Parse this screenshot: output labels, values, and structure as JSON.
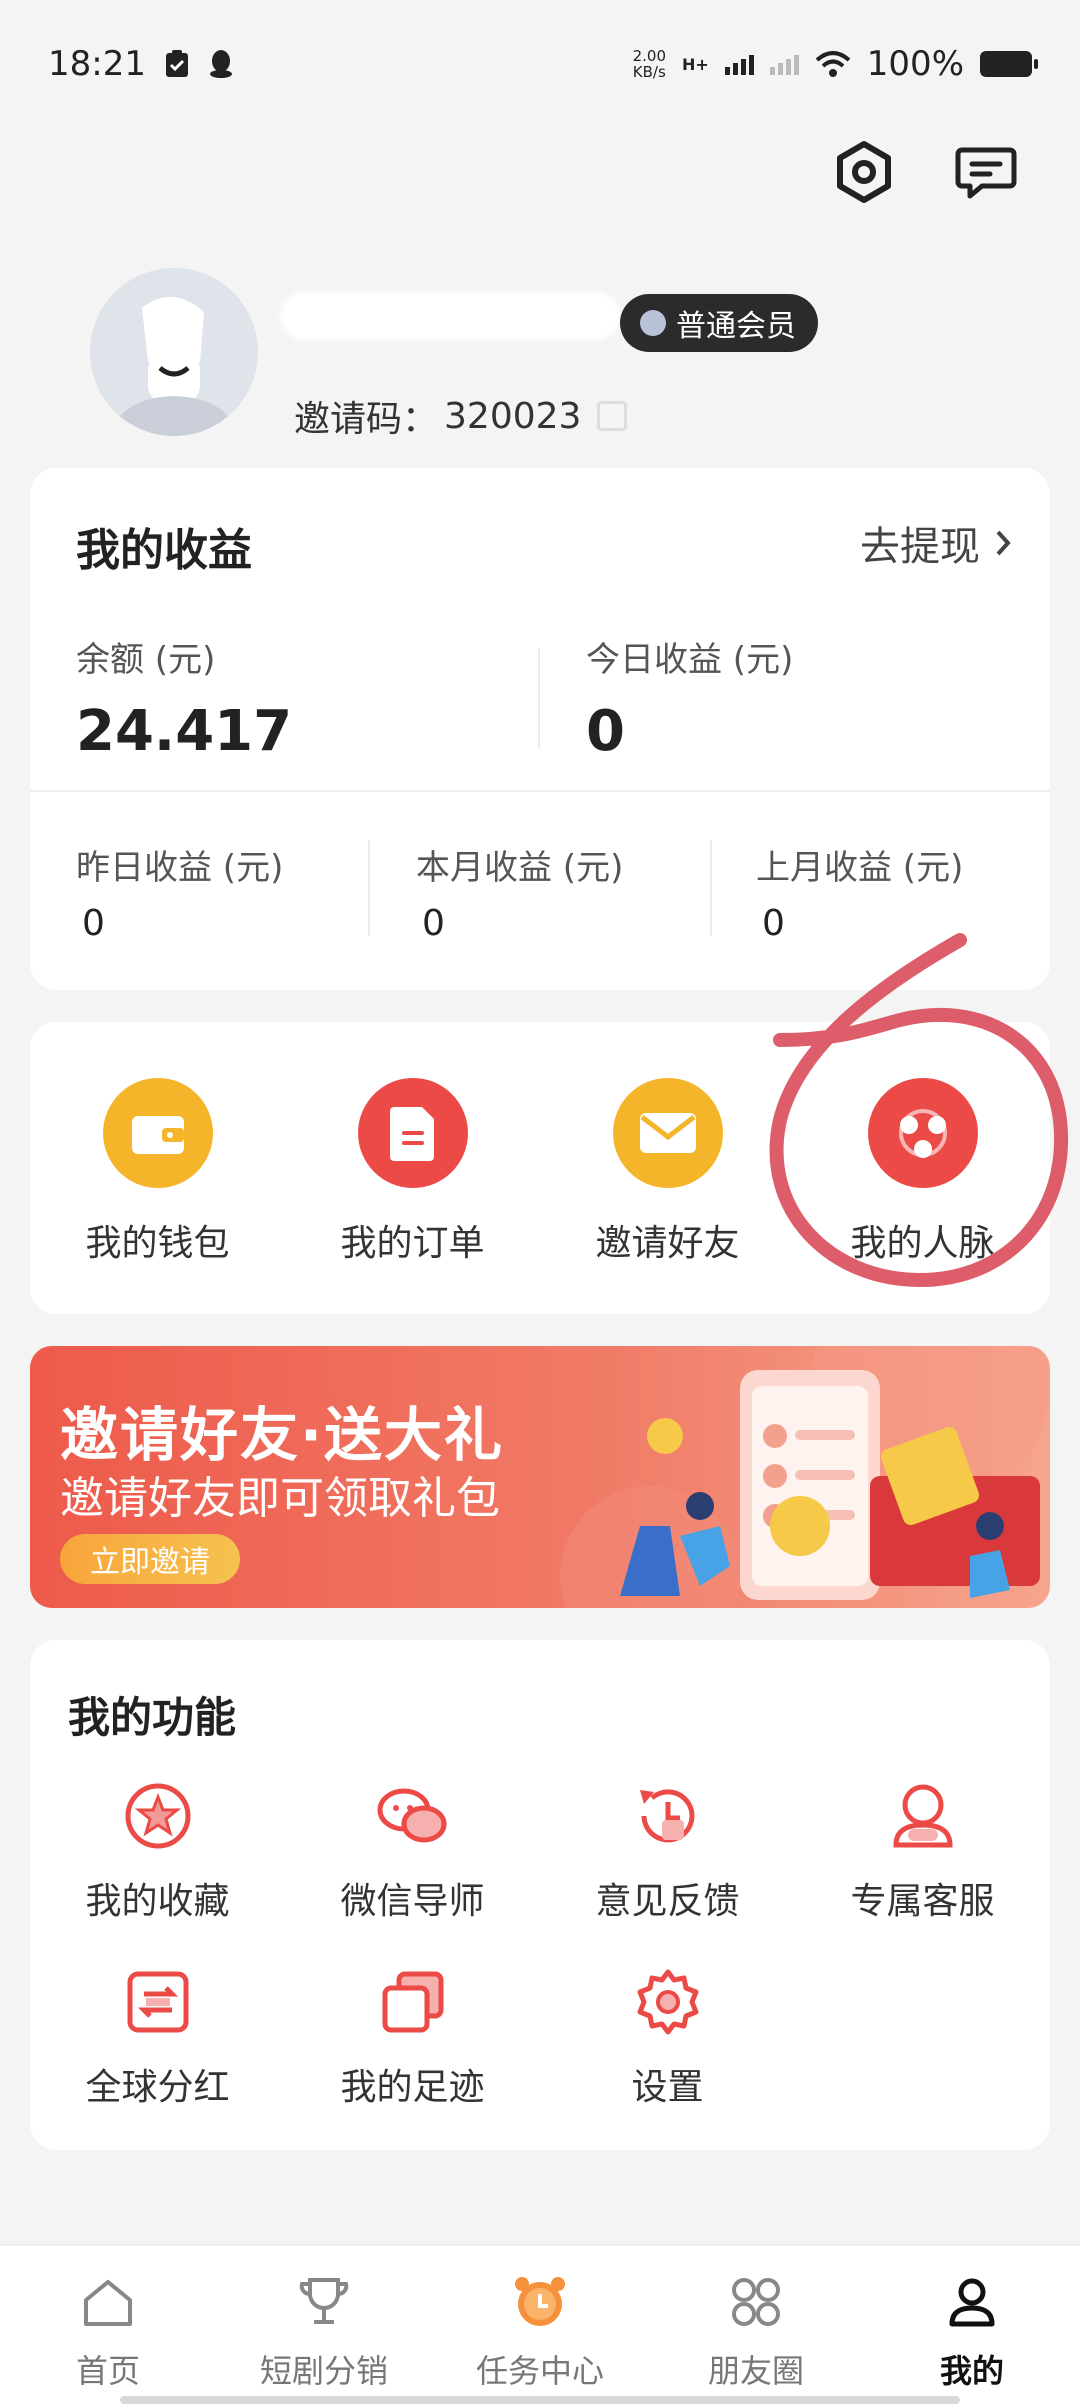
{
  "status_bar": {
    "time": "18:21",
    "net_speed_value": "2.00",
    "net_speed_unit": "KB/s",
    "network_type": "H+",
    "battery": "100%"
  },
  "header": {
    "settings_icon": "hexagon-settings-icon",
    "message_icon": "chat-message-icon"
  },
  "profile": {
    "member_level": "普通会员",
    "invite_label": "邀请码：",
    "invite_code": "320023"
  },
  "earnings": {
    "title": "我的收益",
    "withdraw_label": "去提现",
    "balance_label": "余额 (元)",
    "balance_value": "24.417",
    "today_label": "今日收益 (元)",
    "today_value": "0",
    "yesterday_label": "昨日收益 (元)",
    "yesterday_value": "0",
    "month_label": "本月收益 (元)",
    "month_value": "0",
    "last_month_label": "上月收益 (元)",
    "last_month_value": "0"
  },
  "quick_actions": [
    {
      "label": "我的钱包",
      "icon": "wallet-icon",
      "color": "#f5b52b"
    },
    {
      "label": "我的订单",
      "icon": "order-icon",
      "color": "#ec4a46"
    },
    {
      "label": "邀请好友",
      "icon": "envelope-icon",
      "color": "#f5b52b"
    },
    {
      "label": "我的人脉",
      "icon": "network-icon",
      "color": "#ec4a46"
    }
  ],
  "banner": {
    "title": "邀请好友·送大礼",
    "subtitle": "邀请好友即可领取礼包",
    "button": "立即邀请"
  },
  "functions": {
    "title": "我的功能",
    "items": [
      {
        "label": "我的收藏",
        "icon": "star-badge-icon"
      },
      {
        "label": "微信导师",
        "icon": "wechat-icon"
      },
      {
        "label": "意见反馈",
        "icon": "history-clock-icon"
      },
      {
        "label": "专属客服",
        "icon": "customer-service-icon"
      },
      {
        "label": "全球分红",
        "icon": "dividend-icon"
      },
      {
        "label": "我的足迹",
        "icon": "footprint-icon"
      },
      {
        "label": "设置",
        "icon": "gear-icon"
      }
    ]
  },
  "bottom_nav": [
    {
      "label": "首页",
      "icon": "home-icon"
    },
    {
      "label": "短剧分销",
      "icon": "trophy-icon"
    },
    {
      "label": "任务中心",
      "icon": "alarm-clock-icon"
    },
    {
      "label": "朋友圈",
      "icon": "four-circles-icon"
    },
    {
      "label": "我的",
      "icon": "user-icon",
      "active": true
    }
  ],
  "colors": {
    "accent_red": "#ec4a46",
    "accent_yellow": "#f5b52b",
    "annotation_red": "#d94b5a"
  }
}
